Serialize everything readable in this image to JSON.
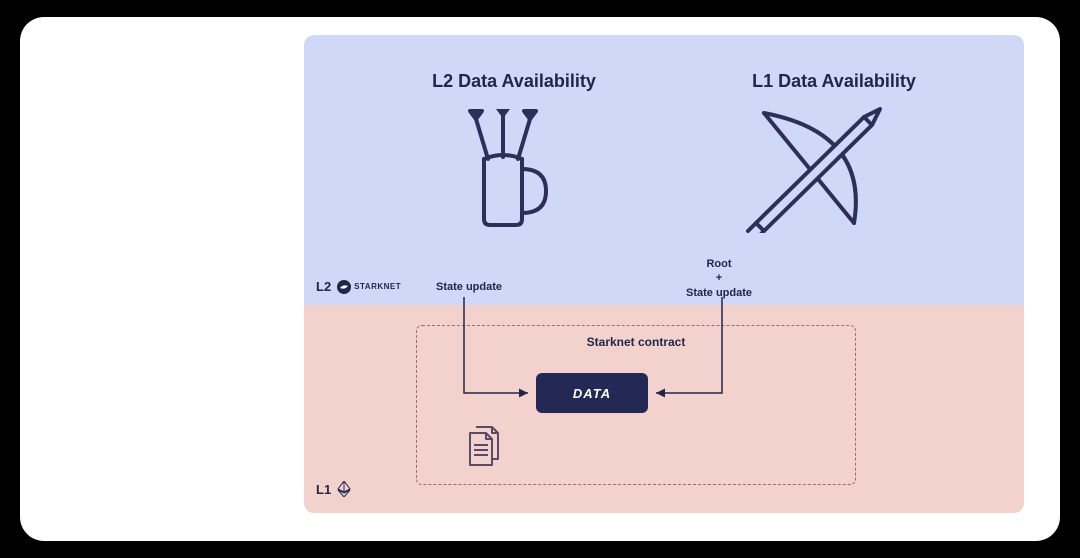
{
  "diagram": {
    "l2_heading": "L2 Data Availability",
    "l1_heading": "L1 Data Availability",
    "layer_l2_label": "L2",
    "layer_l1_label": "L1",
    "starknet_label": "STARKNET",
    "edge_left_label": "State update",
    "edge_right_label": "Root\n+\nState update",
    "contract_box_label": "Starknet contract",
    "data_box_label": "DATA",
    "icons": {
      "l2_icon": "quiver-with-arrows",
      "l1_icon": "bow-and-arrow",
      "l1_chain_icon": "ethereum",
      "contract_docs_icon": "documents"
    },
    "colors": {
      "l2_bg": "#cfd8f6",
      "l1_bg": "#f3d2cd",
      "ink": "#20284a",
      "data_box": "#242855"
    }
  }
}
